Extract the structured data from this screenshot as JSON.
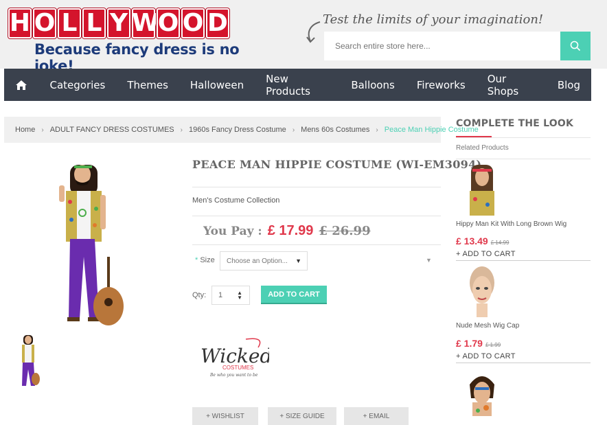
{
  "header": {
    "logo_letters": [
      "H",
      "O",
      "L",
      "L",
      "Y",
      "W",
      "O",
      "O",
      "D"
    ],
    "logo_tagline": "Because fancy dress is no joke!",
    "tagline": "Test the limits of your imagination!",
    "search_placeholder": "Search entire store here...",
    "search_icon": "search-icon"
  },
  "nav": {
    "home_icon": "home-icon",
    "items": [
      "Categories",
      "Themes",
      "Halloween",
      "New Products",
      "Balloons",
      "Fireworks",
      "Our Shops",
      "Blog"
    ]
  },
  "breadcrumb": {
    "items": [
      "Home",
      "ADULT FANCY DRESS COSTUMES",
      "1960s Fancy Dress Costume",
      "Mens 60s Costumes"
    ],
    "current": "Peace Man Hippie Costume"
  },
  "product": {
    "title": "PEACE MAN HIPPIE COSTUME (WI-EM3094)",
    "collection": "Men's Costume Collection",
    "you_pay_label": "You Pay :",
    "price": "£ 17.99",
    "old_price": "£ 26.99",
    "size_label": "Size",
    "size_required": "*",
    "size_placeholder": "Choose an Option...",
    "qty_label": "Qty:",
    "qty_value": "1",
    "add_to_cart": "ADD TO CART",
    "brand_name": "Wicked",
    "brand_sub": "COSTUMES",
    "brand_slogan": "Be who you want to be",
    "buttons": {
      "wishlist": "+ WISHLIST",
      "size_guide": "+ SIZE GUIDE",
      "email": "+ EMAIL"
    }
  },
  "sidebar": {
    "title": "COMPLETE THE LOOK",
    "related_label": "Related Products",
    "items": [
      {
        "name": "Hippy Man Kit With Long Brown Wig",
        "price": "£ 13.49",
        "old_price": "£ 14.99",
        "add": "+ ADD TO CART"
      },
      {
        "name": "Nude Mesh Wig Cap",
        "price": "£ 1.79",
        "old_price": "£ 1.99",
        "add": "+ ADD TO CART"
      }
    ]
  },
  "colors": {
    "brand_red": "#d4142c",
    "accent_teal": "#4cd0b4",
    "price_red": "#e0384b",
    "nav_bg": "#3a414d"
  }
}
